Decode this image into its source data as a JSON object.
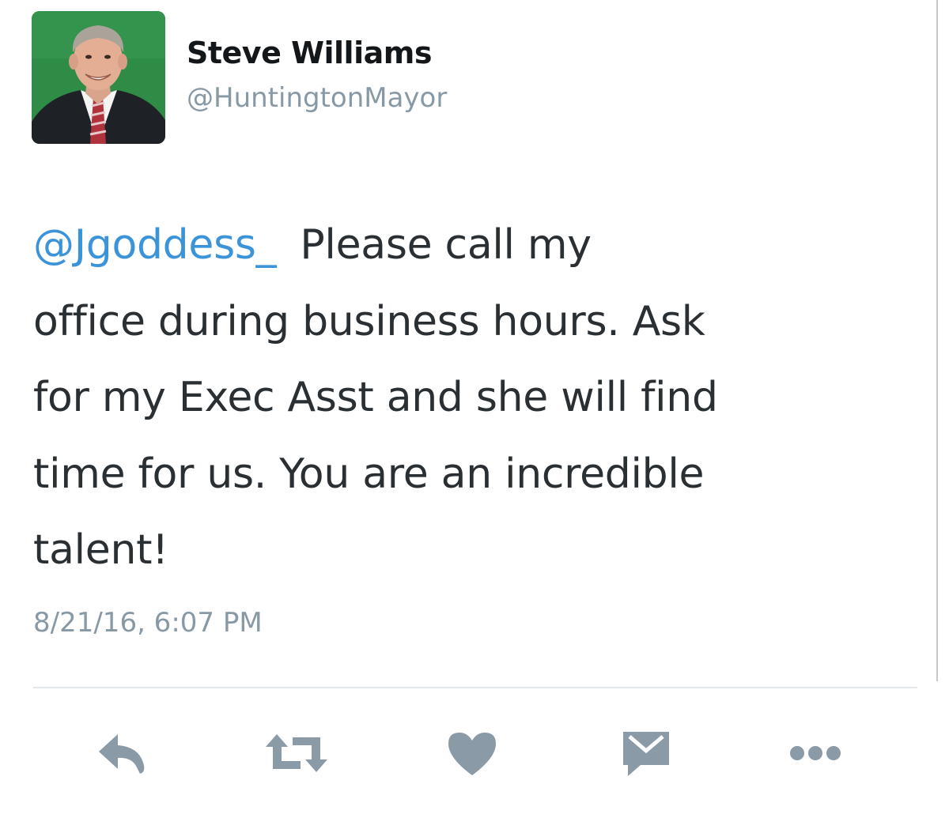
{
  "tweet": {
    "author": {
      "display_name": "Steve Williams",
      "handle": "@HuntingtonMayor"
    },
    "mention": "@Jgoddess_",
    "lines": [
      "Please call my",
      "office during business hours. Ask",
      "for my Exec Asst and she will find",
      "time for us. You are an incredible",
      "talent!"
    ],
    "timestamp": "8/21/16, 6:07 PM"
  },
  "actions": [
    {
      "name": "reply",
      "icon": "reply-icon"
    },
    {
      "name": "retweet",
      "icon": "retweet-icon"
    },
    {
      "name": "like",
      "icon": "heart-icon"
    },
    {
      "name": "direct-message",
      "icon": "envelope-icon"
    },
    {
      "name": "more",
      "icon": "more-dots-icon"
    }
  ],
  "colors": {
    "mention": "#3b94d9",
    "text": "#292f33",
    "secondary": "#8899a6",
    "icon": "#8a9aa7",
    "avatar_background": "#2e8a45"
  }
}
